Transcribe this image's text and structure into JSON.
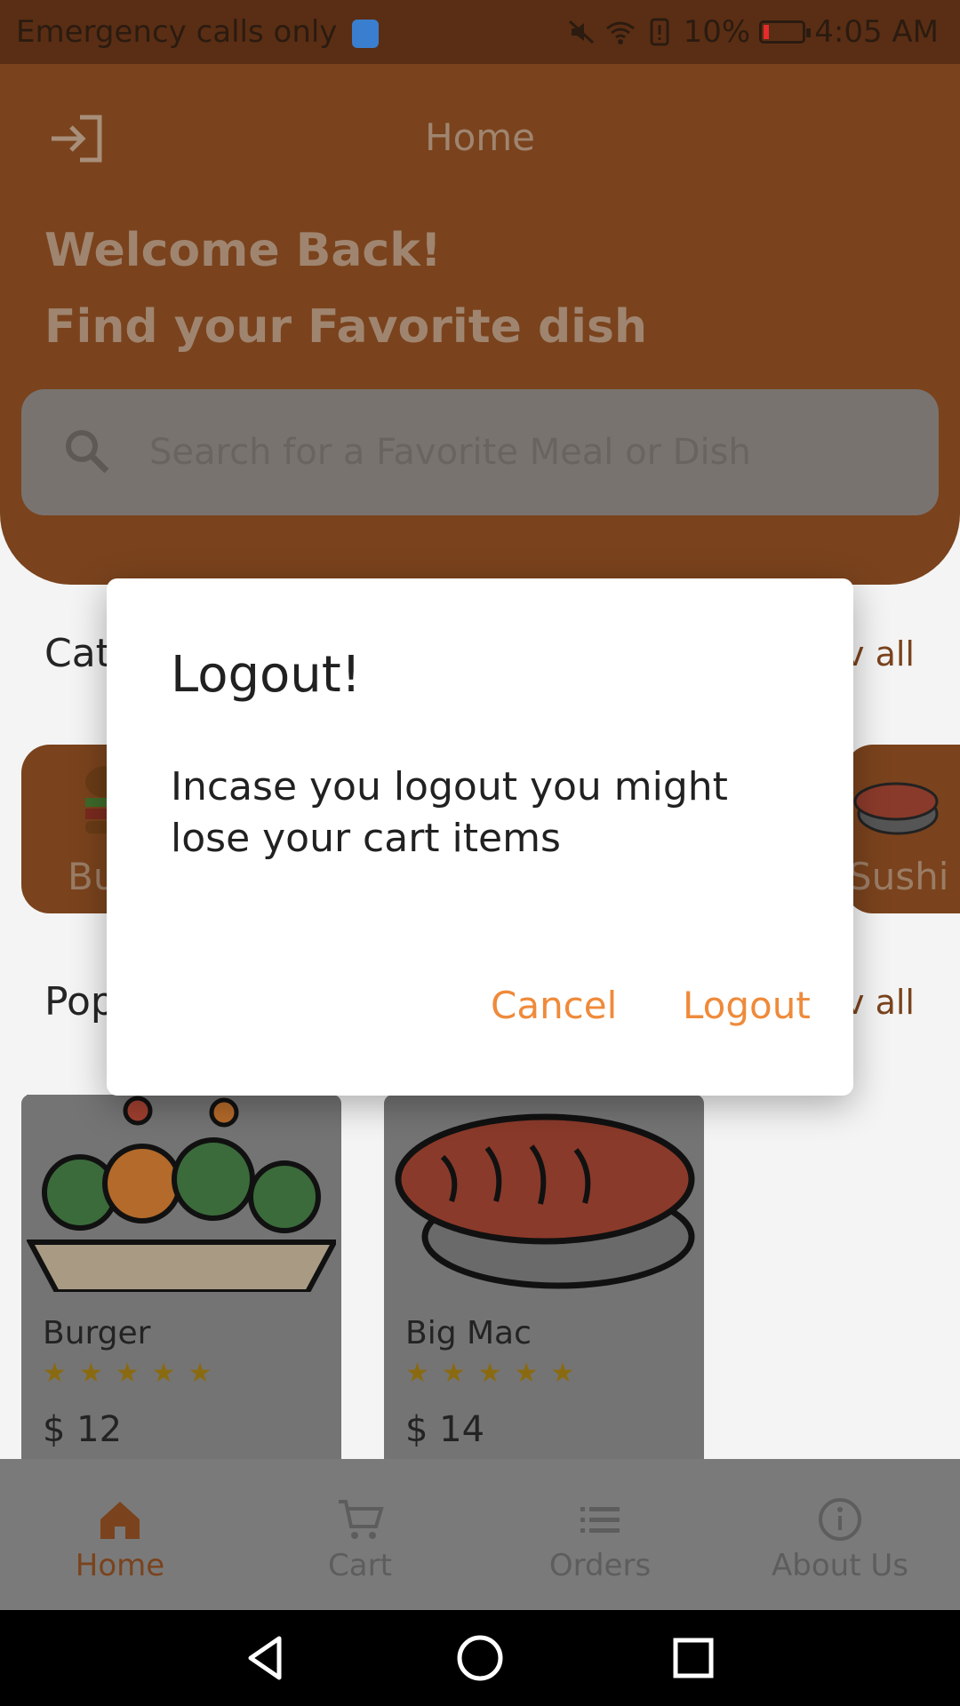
{
  "status_bar": {
    "carrier_text": "Emergency calls only",
    "battery_percent": "10%",
    "time": "4:05 AM"
  },
  "header": {
    "title": "Home",
    "welcome": "Welcome Back!",
    "subtitle": "Find your Favorite dish",
    "search_placeholder": "Search for a Favorite Meal or Dish"
  },
  "categories": {
    "title": "Cat",
    "view_all": "v all",
    "items": [
      {
        "label": "Bu"
      },
      {
        "label": "Sushi"
      }
    ]
  },
  "popular": {
    "title": "Pop",
    "view_all": "v all",
    "items": [
      {
        "name": "Burger",
        "stars": "★★★★★",
        "rating": 5,
        "price": "$ 12"
      },
      {
        "name": "Big Mac",
        "stars": "★★★★★",
        "rating": 5,
        "price": "$ 14"
      }
    ]
  },
  "bottom_nav": {
    "items": [
      {
        "label": "Home",
        "icon": "home-icon",
        "active": true
      },
      {
        "label": "Cart",
        "icon": "cart-icon",
        "active": false
      },
      {
        "label": "Orders",
        "icon": "orders-icon",
        "active": false
      },
      {
        "label": "About Us",
        "icon": "info-icon",
        "active": false
      }
    ]
  },
  "dialog": {
    "title": "Logout!",
    "message": "Incase you logout you might lose your cart items",
    "cancel_label": "Cancel",
    "logout_label": "Logout"
  },
  "colors": {
    "accent": "#ef8a3a",
    "header_dimmed": "#7a431d",
    "dialog_bg": "#ffffff"
  }
}
